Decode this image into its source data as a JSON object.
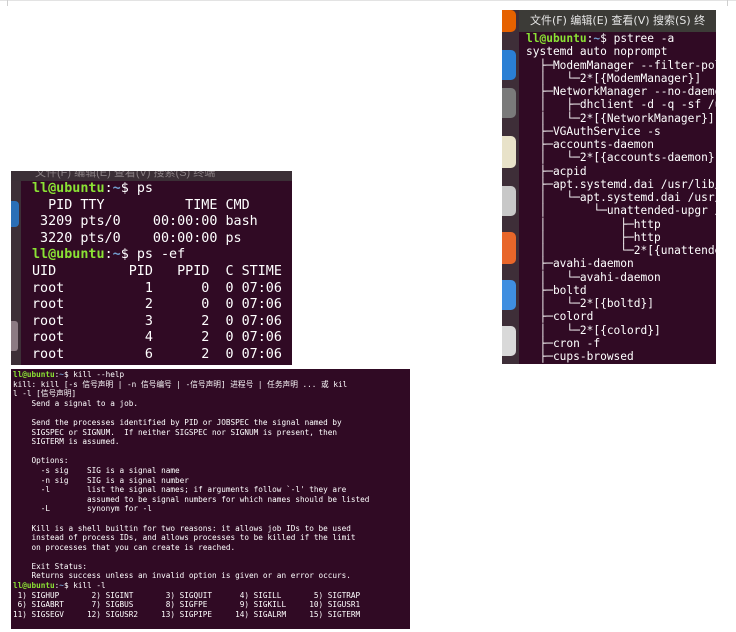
{
  "ps_window": {
    "menu_text": "文件(F)  编辑(E)  查看(V)  搜索(S)  终端",
    "prompt_user": "ll@ubuntu",
    "prompt_path": "~",
    "cmd1": "ps",
    "ps_header": "  PID TTY          TIME CMD",
    "ps_rows": [
      " 3209 pts/0    00:00:00 bash",
      " 3220 pts/0    00:00:00 ps"
    ],
    "cmd2": "ps -ef",
    "ef_header": "UID         PID   PPID  C STIME",
    "ef_rows": [
      "root          1      0  0 07:06",
      "root          2      0  0 07:06",
      "root          3      2  0 07:06",
      "root          4      2  0 07:06",
      "root          6      2  0 07:06"
    ]
  },
  "pstree_window": {
    "menu_text": "文件(F)  编辑(E)  查看(V)  搜索(S)  终",
    "prompt_user": "ll@ubuntu",
    "prompt_path": "~",
    "cmd": "pstree -a",
    "lines": [
      "systemd auto noprompt",
      "  ├─ModemManager --filter-pol",
      "  │   └─2*[{ModemManager}]",
      "  ├─NetworkManager --no-daemo",
      "  │   ├─dhclient -d -q -sf /u",
      "  │   └─2*[{NetworkManager}]",
      "  ├─VGAuthService -s",
      "  ├─accounts-daemon",
      "  │   └─2*[{accounts-daemon}]",
      "  ├─acpid",
      "  ├─apt.systemd.dai /usr/lib/",
      "  │   └─apt.systemd.dai /usr/",
      "  │       └─unattended-upgr /",
      "  │           ├─http",
      "  │           ├─http",
      "  │           └─2*[{unattende",
      "  ├─avahi-daemon",
      "  │   └─avahi-daemon",
      "  ├─boltd",
      "  │   └─2*[{boltd}]",
      "  ├─colord",
      "  │   └─2*[{colord}]",
      "  ├─cron -f",
      "  ├─cups-browsed"
    ],
    "dock_icon_colors": [
      "#e66100",
      "#2a7fd4",
      "#7a7a7a",
      "#e8e2c9",
      "#c8c8c8",
      "#e8662a",
      "#3f8ee0",
      "#d9d9d9"
    ]
  },
  "kill_window": {
    "prompt_user": "ll@ubuntu",
    "prompt_path": "~",
    "cmd1": "kill --help",
    "help_lines": [
      "kill: kill [-s 信号声明 | -n 信号编号 | -信号声明] 进程号 | 任务声明 ... 或 kil",
      "l -l [信号声明]",
      "    Send a signal to a job.",
      "",
      "    Send the processes identified by PID or JOBSPEC the signal named by",
      "    SIGSPEC or SIGNUM.  If neither SIGSPEC nor SIGNUM is present, then",
      "    SIGTERM is assumed.",
      "",
      "    Options:",
      "      -s sig    SIG is a signal name",
      "      -n sig    SIG is a signal number",
      "      -l        list the signal names; if arguments follow `-l' they are",
      "                assumed to be signal numbers for which names should be listed",
      "      -L        synonym for -l",
      "",
      "    Kill is a shell builtin for two reasons: it allows job IDs to be used",
      "    instead of process IDs, and allows processes to be killed if the limit",
      "    on processes that you can create is reached.",
      "",
      "    Exit Status:",
      "    Returns success unless an invalid option is given or an error occurs."
    ],
    "cmd2": "kill -l",
    "signal_lines": [
      " 1) SIGHUP       2) SIGINT       3) SIGQUIT      4) SIGILL       5) SIGTRAP",
      " 6) SIGABRT      7) SIGBUS       8) SIGFPE       9) SIGKILL     10) SIGUSR1",
      "11) SIGSEGV     12) SIGUSR2     13) SIGPIPE     14) SIGALRM     15) SIGTERM"
    ]
  }
}
